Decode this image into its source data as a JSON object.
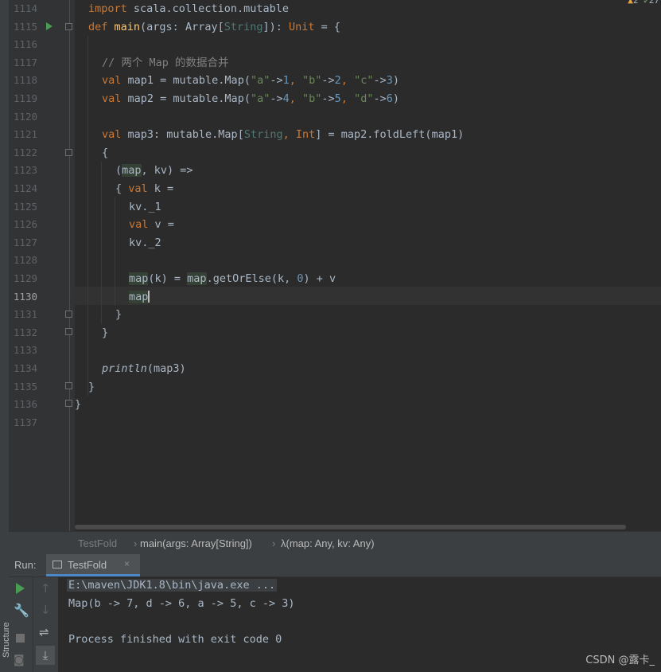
{
  "editor": {
    "lines": [
      {
        "num": "1114"
      },
      {
        "num": "1115"
      },
      {
        "num": "1116"
      },
      {
        "num": "1117"
      },
      {
        "num": "1118"
      },
      {
        "num": "1119"
      },
      {
        "num": "1120"
      },
      {
        "num": "1121"
      },
      {
        "num": "1122"
      },
      {
        "num": "1123"
      },
      {
        "num": "1124"
      },
      {
        "num": "1125"
      },
      {
        "num": "1126"
      },
      {
        "num": "1127"
      },
      {
        "num": "1128"
      },
      {
        "num": "1129"
      },
      {
        "num": "1130"
      },
      {
        "num": "1131"
      },
      {
        "num": "1132"
      },
      {
        "num": "1133"
      },
      {
        "num": "1134"
      },
      {
        "num": "1135"
      },
      {
        "num": "1136"
      },
      {
        "num": "1137"
      }
    ],
    "code": {
      "l1114": {
        "kw": "import",
        "rest": " scala.collection.mutable"
      },
      "l1115": {
        "kw": "def",
        "fn": "main",
        "a": "(args: Array[",
        "typ": "String",
        "b": "]): ",
        "kw2": "Unit",
        "c": " = {"
      },
      "l1117": {
        "comment": "// 两个 Map 的数据合并"
      },
      "l1118": {
        "kw": "val",
        "a": " map1 = mutable.Map(",
        "s1": "\"a\"",
        "o1": "->",
        "n1": "1",
        "c1": ", ",
        "s2": "\"b\"",
        "o2": "->",
        "n2": "2",
        "c2": ", ",
        "s3": "\"c\"",
        "o3": "->",
        "n3": "3",
        "end": ")"
      },
      "l1119": {
        "kw": "val",
        "a": " map2 = mutable.Map(",
        "s1": "\"a\"",
        "o1": "->",
        "n1": "4",
        "c1": ", ",
        "s2": "\"b\"",
        "o2": "->",
        "n2": "5",
        "c2": ", ",
        "s3": "\"d\"",
        "o3": "->",
        "n3": "6",
        "end": ")"
      },
      "l1121": {
        "kw": "val",
        "a": " map3: mutable.Map[",
        "t1": "String",
        "c": ", ",
        "t2": "Int",
        "b": "] = map2.foldLeft(map1)"
      },
      "l1122": {
        "text": "{"
      },
      "l1123": {
        "a": "(",
        "hl": "map",
        "b": ", kv) =>"
      },
      "l1124": {
        "a": "{ ",
        "kw": "val",
        "b": " k ="
      },
      "l1125": {
        "text": "kv._1"
      },
      "l1126": {
        "kw": "val",
        "b": " v ="
      },
      "l1127": {
        "text": "kv._2"
      },
      "l1129": {
        "hl1": "map",
        "a": "(k) = ",
        "hl2": "map",
        "b": ".getOrElse(k, ",
        "n": "0",
        "c": ") + v"
      },
      "l1130": {
        "hl": "map"
      },
      "l1131": {
        "text": "}"
      },
      "l1132": {
        "text": "}"
      },
      "l1134": {
        "fn": "println",
        "rest": "(map3)"
      },
      "l1135": {
        "text": "}"
      },
      "l1136": {
        "text": "}"
      }
    },
    "inspection_counts": {
      "warnings": "2",
      "weak": "27"
    }
  },
  "breadcrumb": {
    "items": [
      "TestFold",
      "main(args: Array[String])",
      "λ(map: Any, kv: Any)"
    ],
    "separator": "›"
  },
  "run_panel": {
    "label": "Run:",
    "tab": {
      "label": "TestFold",
      "close": "×"
    },
    "side_label": "Structure",
    "console": [
      "E:\\maven\\JDK1.8\\bin\\java.exe ...",
      "Map(b -> 7, d -> 6, a -> 5, c -> 3)",
      "",
      "Process finished with exit code 0"
    ]
  },
  "watermark": "CSDN @露卡_"
}
